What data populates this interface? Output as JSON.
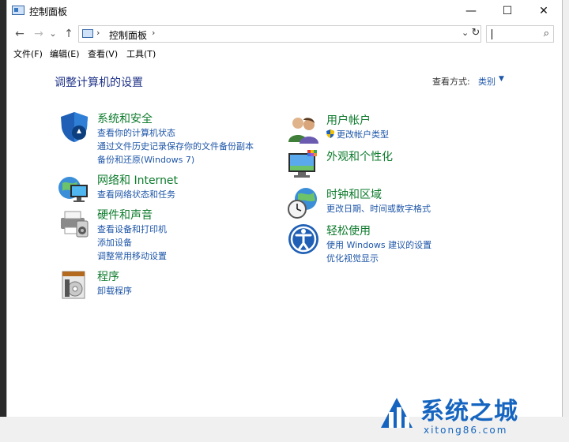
{
  "window": {
    "title": "控制面板",
    "buttons": {
      "minimize": "—",
      "maximize": "☐",
      "close": "✕"
    }
  },
  "address_bar": {
    "back": "←",
    "forward": "→",
    "recent": "⌄",
    "up": "↑",
    "separator": "›",
    "path": "控制面板",
    "trail_separator": "›",
    "dropdown": "⌄",
    "refresh": "↻",
    "search_placeholder": "",
    "search_icon": "⌕"
  },
  "menu": [
    "文件(F)",
    "编辑(E)",
    "查看(V)",
    "工具(T)"
  ],
  "main": {
    "title": "调整计算机的设置",
    "view_by_label": "查看方式:",
    "view_by_value": "类别",
    "view_by_arrow": "▼",
    "left_categories": [
      {
        "title": "系统和安全",
        "icon": "shield-icon",
        "links": [
          "查看你的计算机状态",
          "通过文件历史记录保存你的文件备份副本",
          "备份和还原(Windows 7)"
        ]
      },
      {
        "title": "网络和 Internet",
        "icon": "network-icon",
        "links": [
          "查看网络状态和任务"
        ]
      },
      {
        "title": "硬件和声音",
        "icon": "printer-icon",
        "links": [
          "查看设备和打印机",
          "添加设备",
          "调整常用移动设置"
        ]
      },
      {
        "title": "程序",
        "icon": "programs-icon",
        "links": [
          "卸载程序"
        ]
      }
    ],
    "right_categories": [
      {
        "title": "用户帐户",
        "icon": "users-icon",
        "links": [
          "更改帐户类型"
        ]
      },
      {
        "title": "外观和个性化",
        "icon": "monitor-icon",
        "links": []
      },
      {
        "title": "时钟和区域",
        "icon": "clock-globe-icon",
        "links": [
          "更改日期、时间或数字格式"
        ]
      },
      {
        "title": "轻松使用",
        "icon": "ease-of-access-icon",
        "links": [
          "使用 Windows 建议的设置",
          "优化视觉显示"
        ]
      }
    ]
  },
  "watermark": {
    "title": "系统之城",
    "url": "xitong86.com"
  },
  "colors": {
    "category_title": "#0d7b2c",
    "link": "#1e56a8",
    "page_title": "#1e3287",
    "watermark": "#1565c0"
  }
}
